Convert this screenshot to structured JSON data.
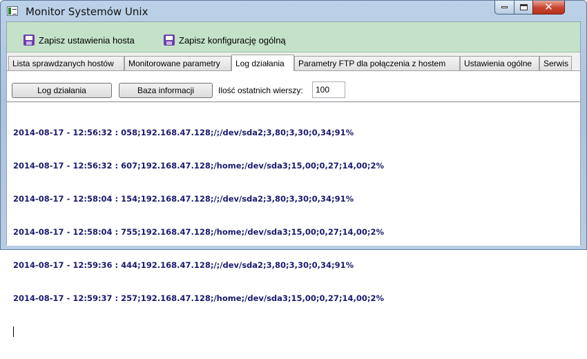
{
  "window": {
    "title": "Monitor Systemów Unix",
    "close_glyph": "✕"
  },
  "toolbar": {
    "save_host_label": "Zapisz ustawienia hosta",
    "save_general_label": "Zapisz konfigurację ogólną"
  },
  "tabs": [
    {
      "label": "Lista sprawdzanych hostów",
      "active": false
    },
    {
      "label": "Monitorowane parametry",
      "active": false
    },
    {
      "label": "Log działania",
      "active": true
    },
    {
      "label": "Parametry FTP dla połączenia z hostem",
      "active": false
    },
    {
      "label": "Ustawienia ogólne",
      "active": false
    },
    {
      "label": "Serwis",
      "active": false
    }
  ],
  "log_panel": {
    "log_button": "Log działania",
    "info_button": "Baza informacji",
    "rows_label": "Ilość ostatnich wierszy:",
    "rows_value": "100",
    "lines": [
      "2014-08-17 - 12:56:32 : 058;192.168.47.128;/;/dev/sda2;3,80;3,30;0,34;91%",
      "2014-08-17 - 12:56:32 : 607;192.168.47.128;/home;/dev/sda3;15,00;0,27;14,00;2%",
      "2014-08-17 - 12:58:04 : 154;192.168.47.128;/;/dev/sda2;3,80;3,30;0,34;91%",
      "2014-08-17 - 12:58:04 : 755;192.168.47.128;/home;/dev/sda3;15,00;0,27;14,00;2%",
      "2014-08-17 - 12:59:36 : 444;192.168.47.128;/;/dev/sda2;3,80;3,30;0,34;91%",
      "2014-08-17 - 12:59:37 : 257;192.168.47.128;/home;/dev/sda3;15,00;0,27;14,00;2%"
    ]
  },
  "colors": {
    "toolbar_bg": "#c4e2c8",
    "log_text": "#1a1a6e",
    "close_button": "#c7432f"
  }
}
